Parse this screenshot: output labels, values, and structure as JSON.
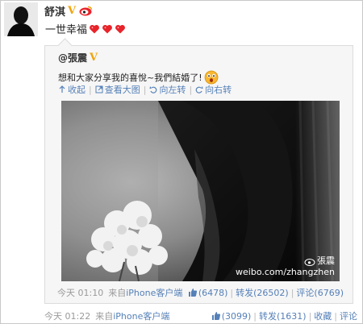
{
  "post": {
    "author": "舒淇",
    "verified_badge": "V",
    "text": "一世幸福",
    "hearts": 3,
    "time": "今天 01:22",
    "source_prefix": "来自",
    "source": "iPhone客户端",
    "likes": "(3099)",
    "repost": "转发(1631)",
    "favorite": "收藏",
    "comment": "评论"
  },
  "quoted": {
    "author": "@張震",
    "verified_badge": "V",
    "text": "想和大家分享我的喜悅~我們結婚了!",
    "image_actions": [
      "收起",
      "查看大图",
      "向左转",
      "向右转"
    ],
    "watermark_user": "張震",
    "watermark_url": "weibo.com/zhangzhen",
    "time": "今天 01:10",
    "source_prefix": "来自",
    "source": "iPhone客户端",
    "likes": "(6478)",
    "repost": "转发(26502)",
    "comment": "评论(6769)"
  },
  "colors": {
    "link": "#5580b8",
    "muted": "#9a9a9a",
    "vip": "#f0a30a",
    "heart": "#e8232a"
  }
}
